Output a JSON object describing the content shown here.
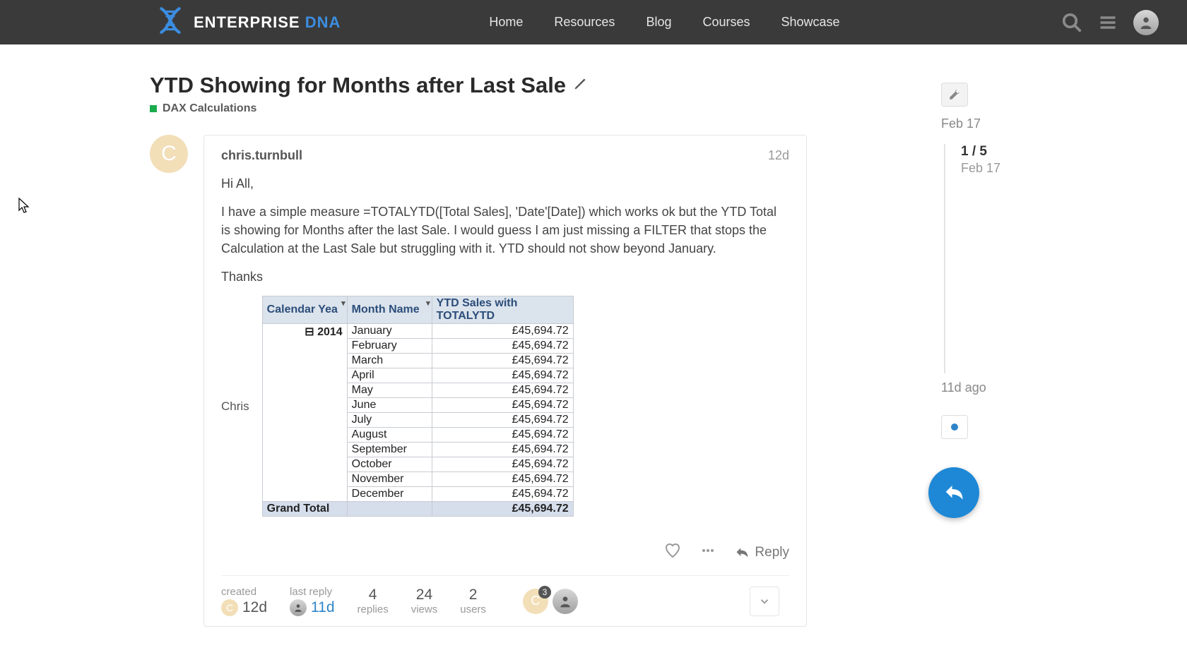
{
  "header": {
    "logo_text_a": "ENTERPRISE ",
    "logo_text_b": "DNA",
    "nav": [
      "Home",
      "Resources",
      "Blog",
      "Courses",
      "Showcase"
    ]
  },
  "topic": {
    "title": "YTD Showing for Months after Last Sale",
    "category": "DAX Calculations"
  },
  "post": {
    "avatar_letter": "C",
    "username": "chris.turnbull",
    "age": "12d",
    "p1": "Hi All,",
    "p2": "I have a simple measure =TOTALYTD([Total Sales], 'Date'[Date]) which works ok but the YTD Total is showing for Months after the last Sale. I would guess I am just missing a FILTER that stops the Calculation at the Last Sale but struggling with it. YTD should not show beyond January.",
    "p3": "Thanks",
    "signature": "Chris"
  },
  "chart_data": {
    "type": "table",
    "columns": [
      "Calendar Yea",
      "Month Name",
      "YTD Sales with TOTALYTD"
    ],
    "year": "2014",
    "rows": [
      {
        "month": "January",
        "value": "£45,694.72"
      },
      {
        "month": "February",
        "value": "£45,694.72"
      },
      {
        "month": "March",
        "value": "£45,694.72"
      },
      {
        "month": "April",
        "value": "£45,694.72"
      },
      {
        "month": "May",
        "value": "£45,694.72"
      },
      {
        "month": "June",
        "value": "£45,694.72"
      },
      {
        "month": "July",
        "value": "£45,694.72"
      },
      {
        "month": "August",
        "value": "£45,694.72"
      },
      {
        "month": "September",
        "value": "£45,694.72"
      },
      {
        "month": "October",
        "value": "£45,694.72"
      },
      {
        "month": "November",
        "value": "£45,694.72"
      },
      {
        "month": "December",
        "value": "£45,694.72"
      }
    ],
    "grand_total_label": "Grand Total",
    "grand_total_value": "£45,694.72"
  },
  "actions": {
    "reply": "Reply"
  },
  "meta": {
    "created_label": "created",
    "created_value": "12d",
    "lastreply_label": "last reply",
    "lastreply_value": "11d",
    "replies_count": "4",
    "replies_label": "replies",
    "views_count": "24",
    "views_label": "views",
    "users_count": "2",
    "users_label": "users",
    "user_badge": "3"
  },
  "timeline": {
    "top_date": "Feb 17",
    "position": "1 / 5",
    "pos_date": "Feb 17",
    "bottom": "11d ago"
  }
}
